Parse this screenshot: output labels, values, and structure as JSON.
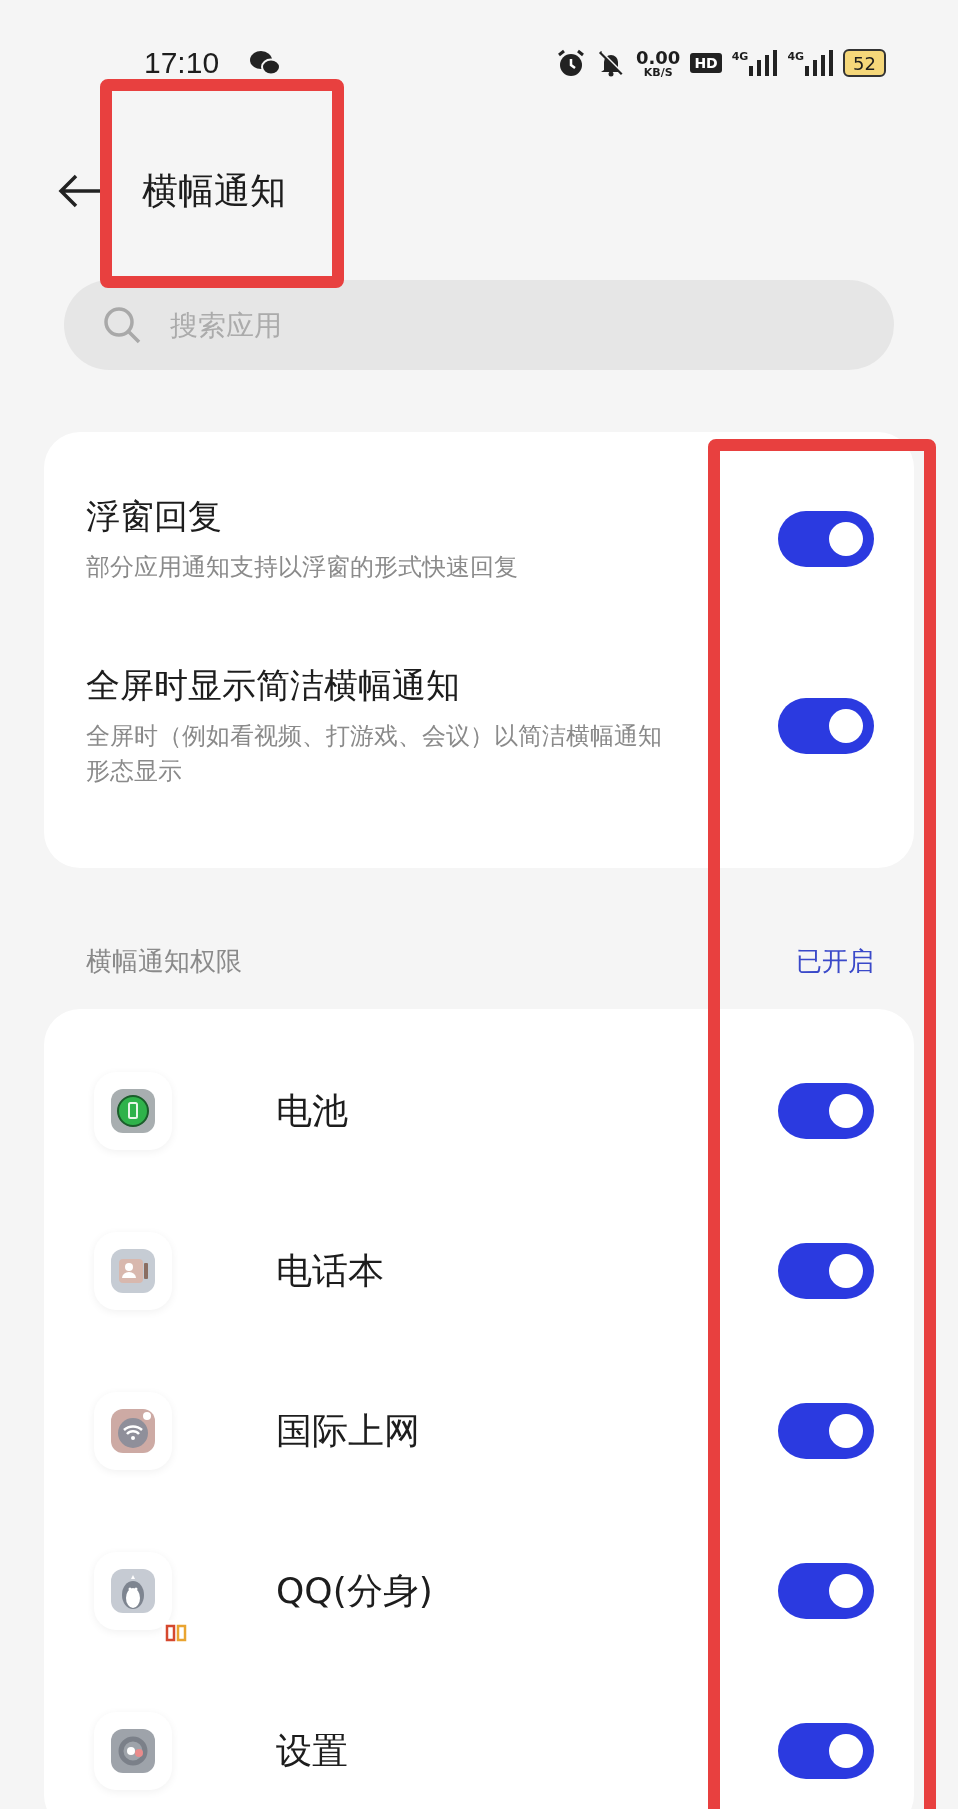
{
  "status_bar": {
    "time": "17:10",
    "speed": "0.00",
    "speed_unit": "KB/S",
    "hd": "HD",
    "networks": [
      "4G",
      "4G"
    ],
    "battery": "52"
  },
  "header": {
    "title": "横幅通知",
    "highlighted": true
  },
  "search": {
    "placeholder": "搜索应用"
  },
  "settings": [
    {
      "title": "浮窗回复",
      "description": "部分应用通知支持以浮窗的形式快速回复",
      "on": true
    },
    {
      "title": "全屏时显示简洁横幅通知",
      "description": "全屏时（例如看视频、打游戏、会议）以简洁横幅通知形态显示",
      "on": true
    }
  ],
  "section": {
    "title": "横幅通知权限",
    "status": "已开启"
  },
  "apps": [
    {
      "name": "电池",
      "kind": "battery",
      "clone": false,
      "on": true
    },
    {
      "name": "电话本",
      "kind": "contacts",
      "clone": false,
      "on": true
    },
    {
      "name": "国际上网",
      "kind": "wifi",
      "clone": false,
      "on": true
    },
    {
      "name": "QQ(分身)",
      "kind": "penguin",
      "clone": true,
      "on": true
    },
    {
      "name": "设置",
      "kind": "gear",
      "clone": false,
      "on": true
    }
  ],
  "toggle_column_highlighted": true
}
